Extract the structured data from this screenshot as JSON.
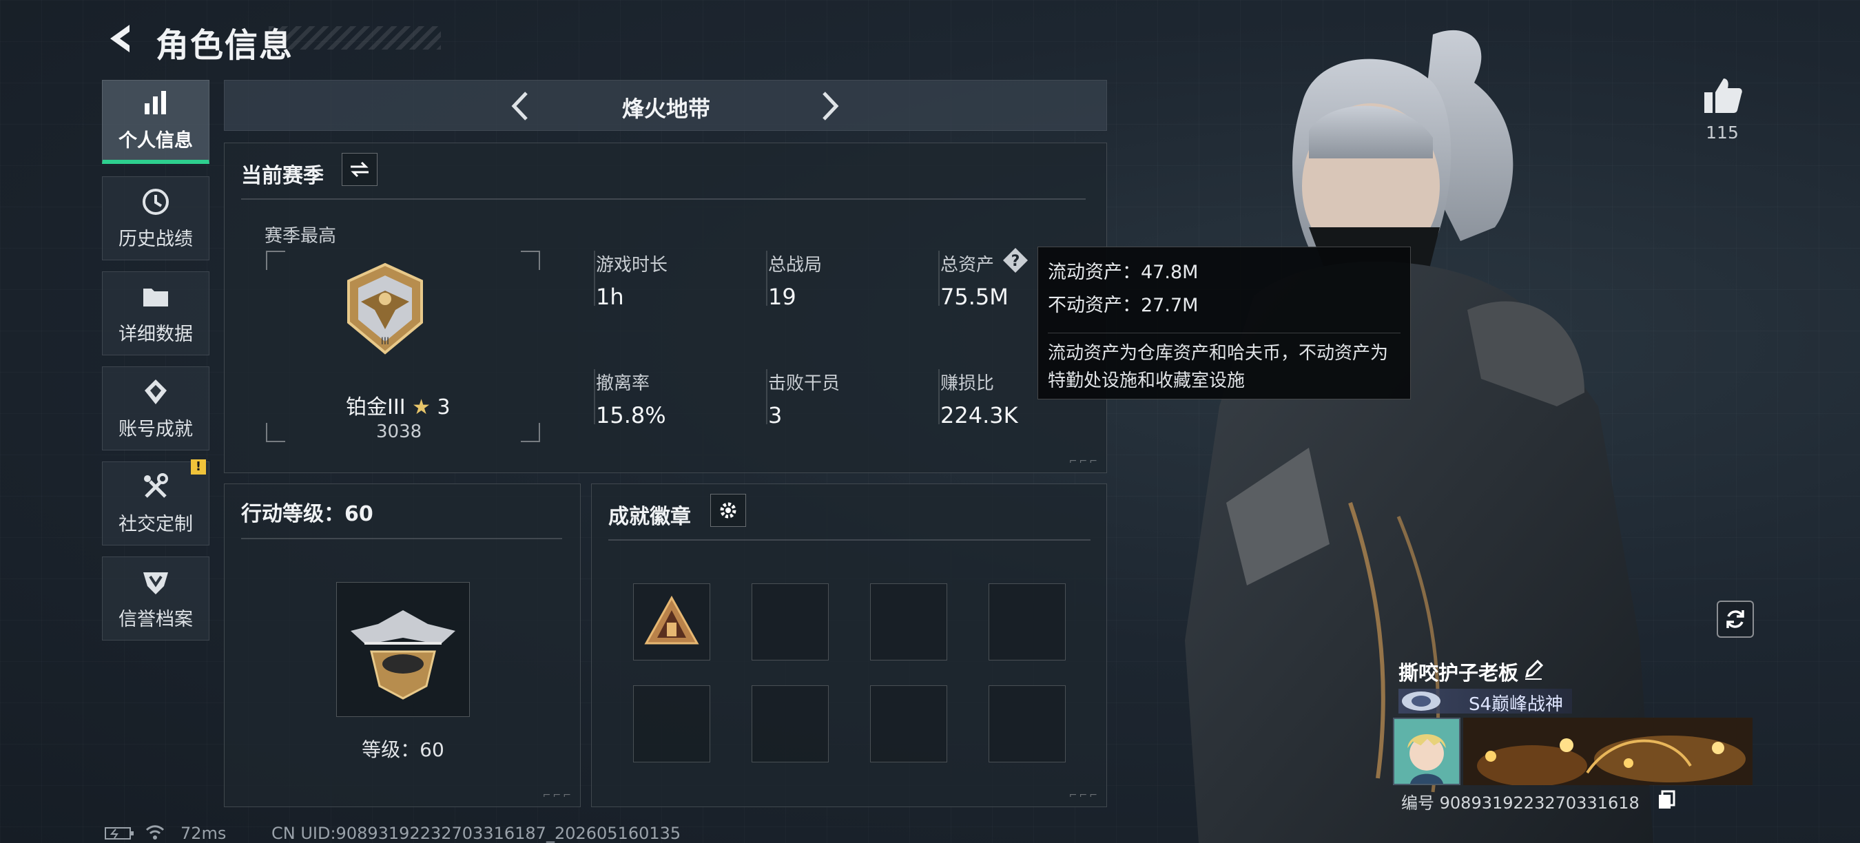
{
  "header": {
    "title": "角色信息"
  },
  "sidebar": {
    "items": [
      {
        "label": "个人信息",
        "icon": "bar-chart-icon",
        "active": true
      },
      {
        "label": "历史战绩",
        "icon": "history-clock-icon"
      },
      {
        "label": "详细数据",
        "icon": "folder-icon"
      },
      {
        "label": "账号成就",
        "icon": "medal-icon"
      },
      {
        "label": "社交定制",
        "icon": "tools-icon",
        "badge": "!"
      },
      {
        "label": "信誉档案",
        "icon": "shield-icon"
      }
    ]
  },
  "mode": {
    "title": "烽火地带"
  },
  "season": {
    "header": "当前赛季",
    "best_label": "赛季最高",
    "rank_name": "铂金III",
    "rank_stars": "3",
    "rank_score": "3038",
    "stats": [
      {
        "label": "游戏时长",
        "value": "1h"
      },
      {
        "label": "总战局",
        "value": "19"
      },
      {
        "label": "总资产",
        "value": "75.5M"
      },
      {
        "label": "撤离率",
        "value": "15.8%"
      },
      {
        "label": "击败干员",
        "value": "3"
      },
      {
        "label": "赚损比",
        "value": "224.3K"
      }
    ]
  },
  "tooltip": {
    "liquid": "流动资产：47.8M",
    "fixed": "不动资产：27.7M",
    "description": "流动资产为仓库资产和哈夫币，不动资产为特勤处设施和收藏室设施"
  },
  "action_level": {
    "header": "行动等级：60",
    "level_text": "等级：60"
  },
  "achievements": {
    "header": "成就徽章"
  },
  "profile": {
    "likes": "115",
    "name": "撕咬护子老板",
    "title_tag": "S4巅峰战神",
    "uid_label": "编号",
    "uid": "9089319223270331618"
  },
  "status_bar": {
    "ping": "72ms",
    "cn_uid": "CN UID:90893192232703316187_202605160135"
  },
  "colors": {
    "accent_green": "#2ecf8f",
    "warning_yellow": "#f0c33a"
  }
}
